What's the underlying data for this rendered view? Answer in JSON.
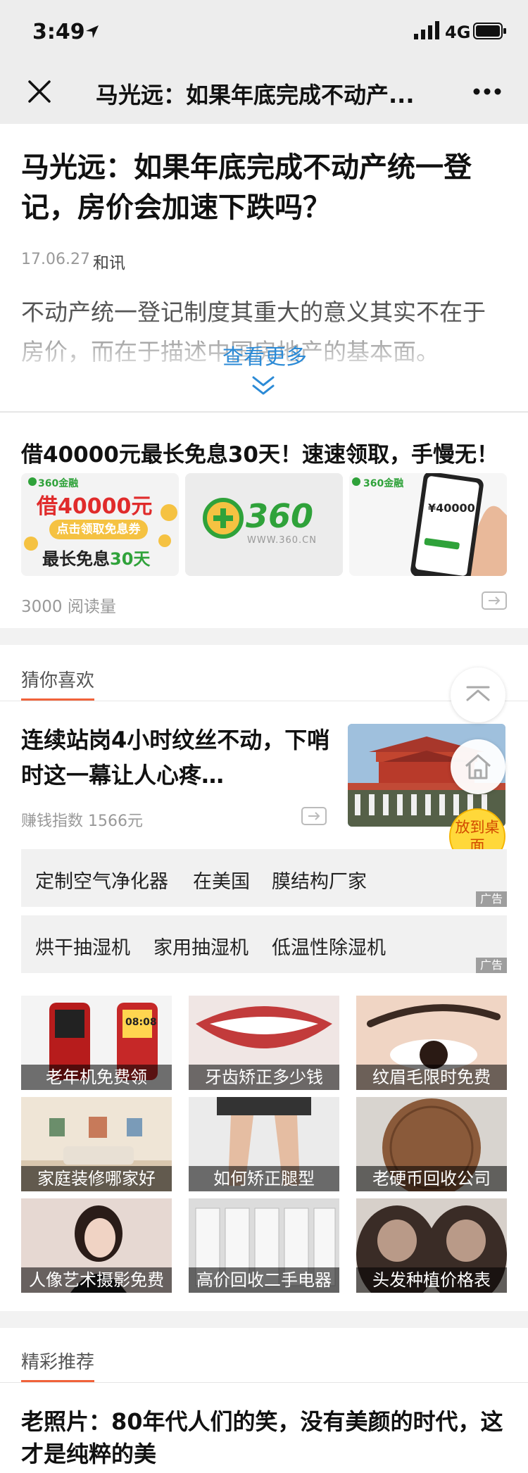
{
  "status_bar": {
    "time": "3:49",
    "network": "4G"
  },
  "nav": {
    "title": "马光远：如果年底完成不动产..."
  },
  "article": {
    "title": "马光远：如果年底完成不动产统一登记，房价会加速下跌吗？",
    "date": "17.06.27",
    "source": "和讯",
    "excerpt": "不动产统一登记制度其重大的意义其实不在于房价，而在于描述中国房地产的基本面。",
    "read_more": "查看更多"
  },
  "ad": {
    "title": "借40000元最长免息30天！速速领取，手慢无！",
    "img1": {
      "brand": "360金融",
      "amount": "借40000元",
      "button": "点击领取免息券",
      "line": "最长免息",
      "days": "30天"
    },
    "img2": {
      "logo": "360",
      "url": "WWW.360.CN"
    },
    "img3": {
      "brand": "360金融",
      "amount": "¥40000"
    },
    "reads": "3000 阅读量"
  },
  "guess": {
    "label": "猜你喜欢",
    "feed": {
      "title": "连续站岗4小时纹丝不动，下哨时这一幕让人心疼…",
      "meta": "赚钱指数 1566元"
    },
    "float_desk": "放到桌面",
    "keywords_row1": [
      "定制空气净化器",
      "在美国",
      "膜结构厂家"
    ],
    "keywords_row2": [
      "烘干抽湿机",
      "家用抽湿机",
      "低温性除湿机"
    ],
    "ad_tag": "广告",
    "tiles": [
      "老年机免费领",
      "牙齿矫正多少钱",
      "纹眉毛限时免费",
      "家庭装修哪家好",
      "如何矫正腿型",
      "老硬币回收公司",
      "人像艺术摄影免费",
      "高价回收二手电器",
      "头发种植价格表"
    ],
    "tile1_clock": "08:08"
  },
  "recommend": {
    "label": "精彩推荐",
    "title": "老照片：80年代人们的笑，没有美颜的时代，这才是纯粹的美"
  },
  "colors": {
    "accent": "#f0623a",
    "link": "#2b8ad6",
    "green": "#2fa23a",
    "red": "#e02b2b"
  }
}
